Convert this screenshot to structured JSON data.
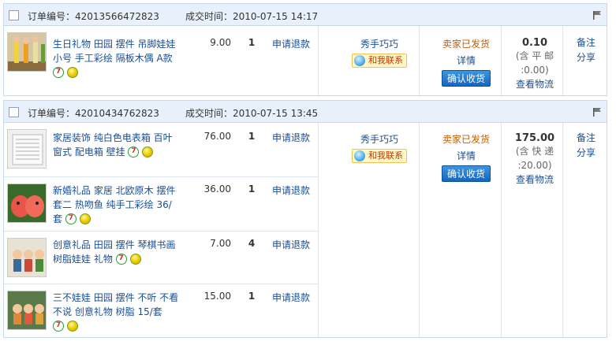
{
  "orders": [
    {
      "order_no_label": "订单编号：",
      "order_no": "42013566472823",
      "deal_time_label": "成交时间：",
      "deal_time": "2010-07-15 14:17",
      "items": [
        {
          "title": "生日礼物 田园 摆件 吊脚娃娃 小号 手工彩绘 隔板木偶 A款",
          "price": "9.00",
          "qty": "1",
          "refund": "申请退款"
        }
      ],
      "seller": "秀手巧巧",
      "contact": "和我联系",
      "status": "卖家已发货",
      "detail": "详情",
      "confirm": "确认收货",
      "total": "0.10",
      "ship_note": "(含 平 邮 :0.00)",
      "logistics": "查看物流",
      "note": "备注",
      "share": "分享"
    },
    {
      "order_no_label": "订单编号：",
      "order_no": "42010434762823",
      "deal_time_label": "成交时间：",
      "deal_time": "2010-07-15 13:45",
      "items": [
        {
          "title": "家居装饰 纯白色电表箱 百叶窗式 配电箱 壁挂",
          "price": "76.00",
          "qty": "1",
          "refund": "申请退款"
        },
        {
          "title": "新婚礼品 家居 北欧原木 摆件 套二 热吻鱼 纯手工彩绘 36/套",
          "price": "36.00",
          "qty": "1",
          "refund": "申请退款"
        },
        {
          "title": "创意礼品 田园 摆件 琴棋书画 树脂娃娃 礼物",
          "price": "7.00",
          "qty": "4",
          "refund": "申请退款"
        },
        {
          "title": "三不娃娃 田园 摆件 不听 不看 不说 创意礼物 树脂 15/套",
          "price": "15.00",
          "qty": "1",
          "refund": "申请退款"
        }
      ],
      "seller": "秀手巧巧",
      "contact": "和我联系",
      "status": "卖家已发货",
      "detail": "详情",
      "confirm": "确认收货",
      "total": "175.00",
      "ship_note": "(含 快 递 :20.00)",
      "logistics": "查看物流",
      "note": "备注",
      "share": "分享"
    }
  ],
  "icons": {
    "flag": "flag-icon",
    "badge_7": "seven-day-return-badge",
    "badge_gold": "gold-seller-badge",
    "contact": "chat-icon"
  },
  "colors": {
    "link": "#1a4e93",
    "status": "#c65e00",
    "header_bg": "#e8f1fb",
    "button": "#1366c3"
  }
}
